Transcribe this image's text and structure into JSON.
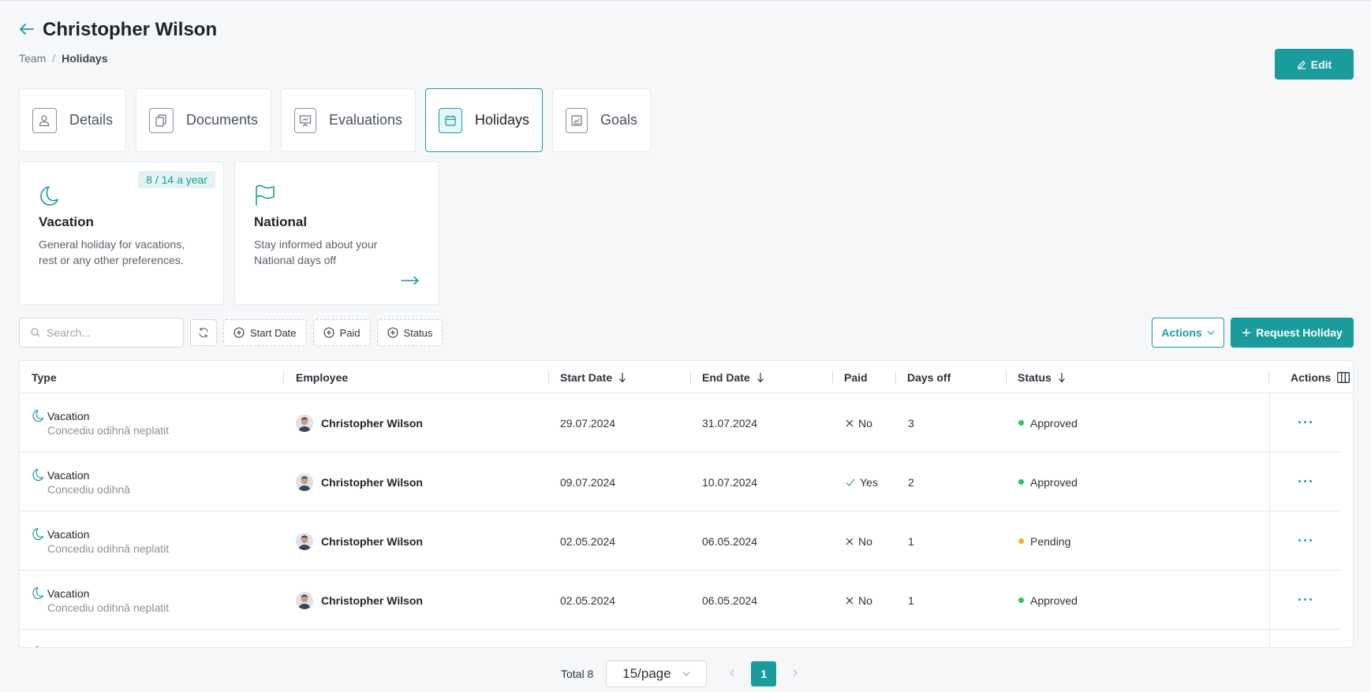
{
  "header": {
    "back_icon": "arrow-left-icon",
    "title": "Christopher Wilson",
    "edit_label": "Edit"
  },
  "breadcrumb": {
    "items": [
      "Team",
      "Holidays"
    ],
    "separator": "/"
  },
  "tabs": [
    {
      "label": "Details",
      "icon": "user-icon",
      "active": false
    },
    {
      "label": "Documents",
      "icon": "documents-icon",
      "active": false
    },
    {
      "label": "Evaluations",
      "icon": "presentation-icon",
      "active": false
    },
    {
      "label": "Holidays",
      "icon": "calendar-icon",
      "active": true
    },
    {
      "label": "Goals",
      "icon": "chart-icon",
      "active": false
    }
  ],
  "cards": [
    {
      "title": "Vacation",
      "description": "General holiday for vacations, rest or any other preferences.",
      "badge": "8 / 14 a year",
      "icon": "moon-icon"
    },
    {
      "title": "National",
      "description": "Stay informed about your National days off",
      "icon": "flag-icon",
      "link_icon": "arrow-right-icon"
    }
  ],
  "filters": {
    "search_placeholder": "Search...",
    "chips": [
      "Start Date",
      "Paid",
      "Status"
    ],
    "actions_label": "Actions",
    "request_label": "Request Holiday"
  },
  "table": {
    "columns": [
      "Type",
      "Employee",
      "Start Date",
      "End Date",
      "Paid",
      "Days off",
      "Status",
      "Actions"
    ],
    "rows": [
      {
        "type": "Vacation",
        "subtype": "Concediu odihnă neplatit",
        "employee": "Christopher Wilson",
        "start": "29.07.2024",
        "end": "31.07.2024",
        "paid": "No",
        "days": "3",
        "status": "Approved",
        "status_color": "#2ec26a"
      },
      {
        "type": "Vacation",
        "subtype": "Concediu odihnă",
        "employee": "Christopher Wilson",
        "start": "09.07.2024",
        "end": "10.07.2024",
        "paid": "Yes",
        "days": "2",
        "status": "Approved",
        "status_color": "#2ec26a"
      },
      {
        "type": "Vacation",
        "subtype": "Concediu odihnă neplatit",
        "employee": "Christopher Wilson",
        "start": "02.05.2024",
        "end": "06.05.2024",
        "paid": "No",
        "days": "1",
        "status": "Pending",
        "status_color": "#f0b429"
      },
      {
        "type": "Vacation",
        "subtype": "Concediu odihnă neplatit",
        "employee": "Christopher Wilson",
        "start": "02.05.2024",
        "end": "06.05.2024",
        "paid": "No",
        "days": "1",
        "status": "Approved",
        "status_color": "#2ec26a"
      }
    ]
  },
  "pagination": {
    "total_label": "Total 8",
    "page_size": "15/page",
    "current_page": "1"
  },
  "colors": {
    "accent": "#1a9c9c",
    "approved": "#2ec26a",
    "pending": "#f0b429"
  }
}
